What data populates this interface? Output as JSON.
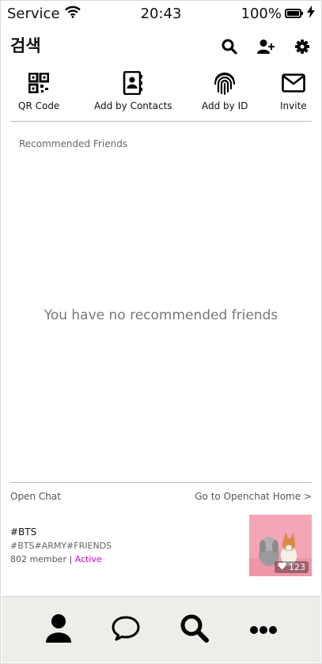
{
  "status_bar": {
    "carrier": "Service",
    "time": "20:43",
    "battery_percent": "100%",
    "icons": [
      "wifi-icon",
      "battery-icon",
      "charging-bolt-icon"
    ]
  },
  "header": {
    "title": "검색",
    "actions": [
      "search-icon",
      "add-friend-icon",
      "gear-icon"
    ]
  },
  "add_options": [
    {
      "label": "QR Code",
      "icon": "qr-code-icon"
    },
    {
      "label": "Add by Contacts",
      "icon": "contacts-book-icon"
    },
    {
      "label": "Add by ID",
      "icon": "fingerprint-icon"
    },
    {
      "label": "Invite",
      "icon": "envelope-icon"
    }
  ],
  "recommended": {
    "label": "Recommended Friends",
    "empty_message": "You have no recommended friends"
  },
  "open_chat": {
    "label": "Open Chat",
    "link": "Go to Openchat Home >",
    "card": {
      "name": "#BTS",
      "tags": "#BTS#ARMY#FRIENDS",
      "members": "802 member",
      "separator": " | ",
      "status": "Active",
      "likes": "123",
      "thumbnail_colors": {
        "background": "#f3a6b7"
      }
    }
  },
  "tab_bar": {
    "tabs": [
      "person-icon",
      "chat-bubble-icon",
      "search-icon",
      "more-dots-icon"
    ],
    "background": "#efedea"
  },
  "colors": {
    "active_status": "#d400d4",
    "divider": "#bdbdbd"
  }
}
